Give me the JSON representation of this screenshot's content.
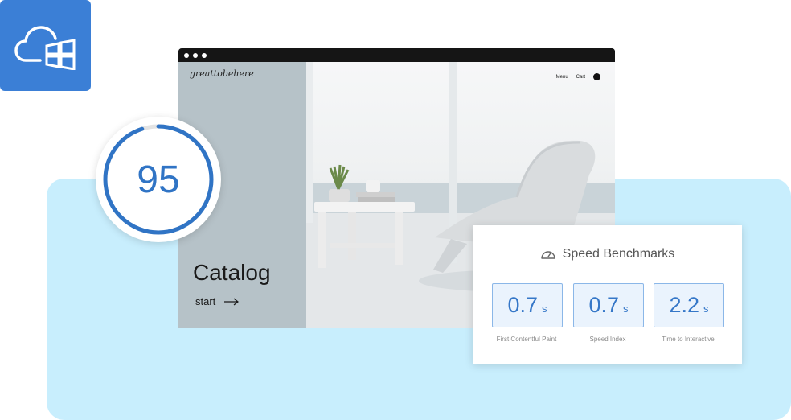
{
  "browser": {
    "site": {
      "logo": "greattobehere",
      "nav": {
        "menu": "Menu",
        "cart": "Cart"
      },
      "heading": "Catalog",
      "cta": "start"
    }
  },
  "score": {
    "value": "95",
    "fraction": 0.95
  },
  "benchmarks": {
    "title": "Speed Benchmarks",
    "metrics": [
      {
        "value": "0.7",
        "unit": "s",
        "label": "First Contentful Paint"
      },
      {
        "value": "0.7",
        "unit": "s",
        "label": "Speed Index"
      },
      {
        "value": "2.2",
        "unit": "s",
        "label": "Time to Interactive"
      }
    ]
  },
  "colors": {
    "accent": "#3b7fd6",
    "panel": "#c8eefd",
    "score": "#3074c5"
  },
  "icons": {
    "tile": "cloud-windows-icon",
    "benchmark": "speedometer-icon",
    "cta": "arrow-right-icon"
  }
}
